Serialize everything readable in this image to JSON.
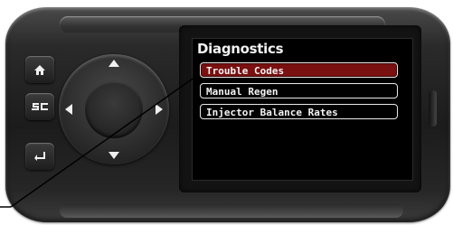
{
  "screen": {
    "title": "Diagnostics",
    "menu": [
      {
        "label": "Trouble Codes",
        "selected": true
      },
      {
        "label": "Manual Regen",
        "selected": false
      },
      {
        "label": "Injector Balance Rates",
        "selected": false
      }
    ]
  },
  "buttons": {
    "home": {
      "icon": "home-icon"
    },
    "sc": {
      "label": "SC"
    },
    "back": {
      "icon": "enter-back-icon"
    }
  },
  "dpad": {
    "icons": [
      "arrow-up-icon",
      "arrow-down-icon",
      "arrow-left-icon",
      "arrow-right-icon"
    ]
  },
  "colors": {
    "device_body": "#1c1c1c",
    "screen_bg": "#000000",
    "selected_item": "#7a1010",
    "item_border": "#e8e8e8"
  }
}
